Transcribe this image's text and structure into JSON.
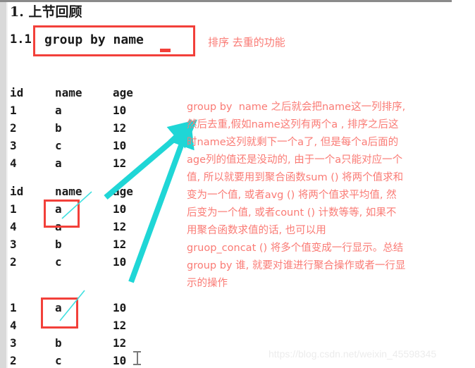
{
  "document": {
    "heading1": "1. 上节回顾",
    "heading2_number": "1.1",
    "code_snippet": "group by name",
    "side_note": "排序 去重的功能"
  },
  "colors": {
    "annotation_red": "#fa7b75",
    "box_red": "#f2403a",
    "arrow_cyan": "#1fd6d6",
    "text_black": "#1a1a1a",
    "gutter_gray": "#d9d9d9",
    "watermark_gray": "#ececec"
  },
  "tables": [
    {
      "name": "original-table",
      "has_header": true,
      "headers": [
        "id",
        "name",
        "age"
      ],
      "rows": [
        [
          "1",
          "a",
          "10"
        ],
        [
          "2",
          "b",
          "12"
        ],
        [
          "3",
          "c",
          "10"
        ],
        [
          "4",
          "a",
          "12"
        ]
      ]
    },
    {
      "name": "sorted-table",
      "has_header": true,
      "headers": [
        "id",
        "name",
        "age"
      ],
      "rows": [
        [
          "1",
          "a",
          "10"
        ],
        [
          "4",
          "a",
          "12"
        ],
        [
          "3",
          "b",
          "12"
        ],
        [
          "2",
          "c",
          "10"
        ]
      ]
    },
    {
      "name": "deduplicated-table",
      "has_header": false,
      "headers": [
        "",
        "",
        ""
      ],
      "rows": [
        [
          "1",
          "a",
          "10"
        ],
        [
          "4",
          "",
          "12"
        ],
        [
          "3",
          "b",
          "12"
        ],
        [
          "2",
          "c",
          "10"
        ]
      ]
    }
  ],
  "annotation": {
    "lines": [
      "group by  name 之后就会把name这一列排序,",
      "然后去重,假如name这列有两个a , 排序之后这",
      "时name这列就剩下一个a了, 但是每个a后面的",
      "age列的值还是没动的, 由于一个a只能对应一个",
      "值, 所以就要用到聚合函数sum () 将两个值求和",
      "变为一个值, 或者avg () 将两个值求平均值, 然",
      "后变为一个值, 或者count () 计数等等, 如果不",
      "用聚合函数求值的话, 也可以用",
      "gruop_concat () 将多个值变成一行显示。总结",
      "group by 谁, 就要对谁进行聚合操作或者一行显",
      "示的操作"
    ]
  },
  "watermark": {
    "text": "https://blog.csdn.net/weixin_45598345"
  }
}
